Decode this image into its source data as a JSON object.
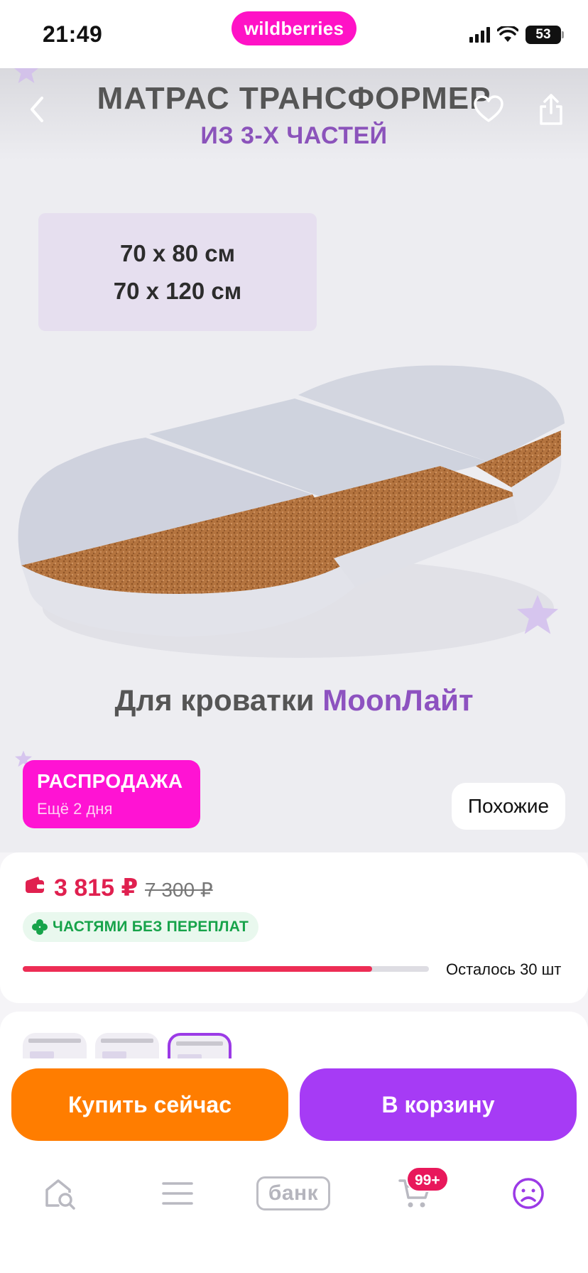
{
  "status_bar": {
    "time": "21:49",
    "brand": "wildberries",
    "battery": "53"
  },
  "gallery": {
    "title_line1": "МАТРАС ТРАНСФОРМЕР",
    "title_line2": "ИЗ 3-Х ЧАСТЕЙ",
    "size_line1": "70 х 80 см",
    "size_line2": "70 х 120 см",
    "caption_prefix": "Для кроватки ",
    "caption_brand": "MoonЛайт",
    "sale_badge": {
      "title": "РАСПРОДАЖА",
      "subtitle": "Ещё 2 дня"
    },
    "similar_label": "Похожие"
  },
  "price": {
    "current": "3 815 ₽",
    "old": "7 300 ₽",
    "installment_label": "ЧАСТЯМИ БЕЗ ПЕРЕПЛАТ",
    "stock_text": "Осталось 30 шт",
    "stock_progress": 0.86
  },
  "actions": {
    "buy_now": "Купить сейчас",
    "add_to_cart": "В корзину"
  },
  "tabbar": {
    "bank_label": "банк",
    "cart_badge": "99+",
    "active_tab": "profile"
  },
  "colors": {
    "brand_pink": "#ff12c6",
    "price_red": "#e0204f",
    "buy_orange": "#ff7d00",
    "cart_purple": "#a63bf5",
    "installment_green": "#17a34a",
    "caption_purple": "#8d52c0"
  }
}
